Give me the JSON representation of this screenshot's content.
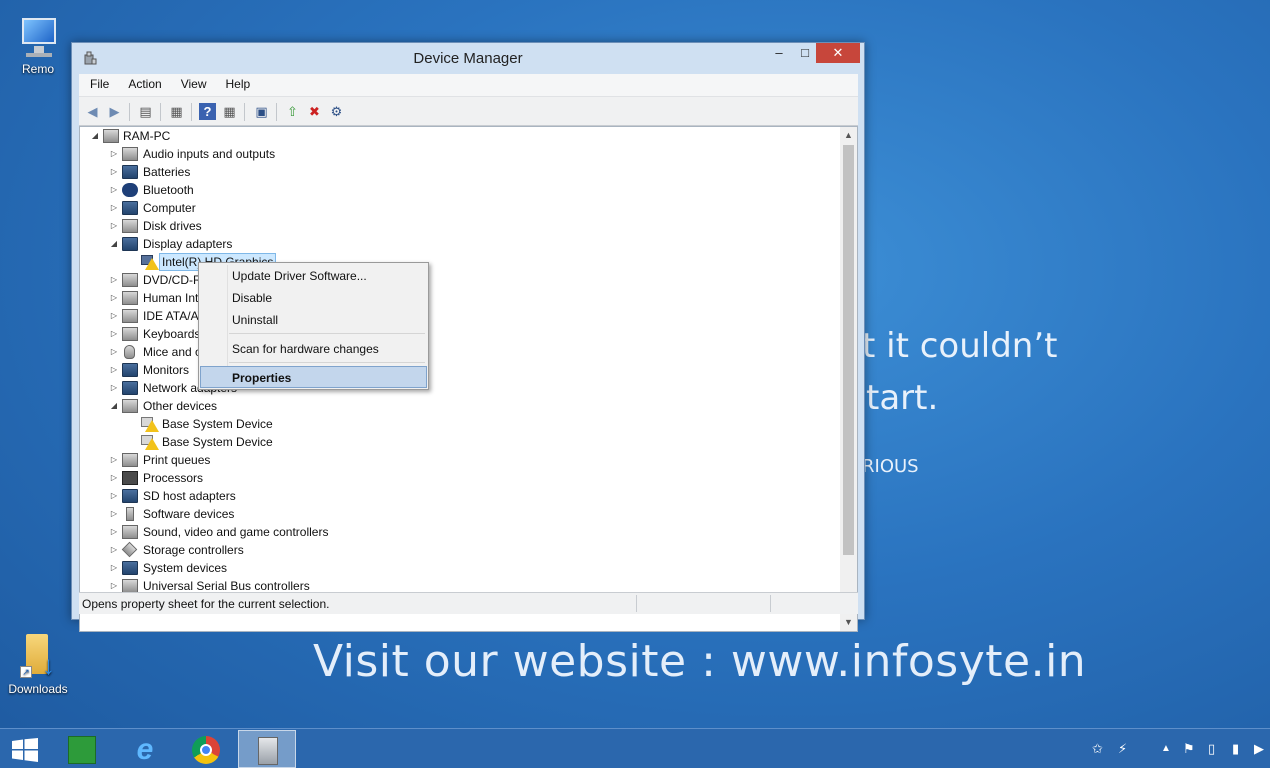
{
  "desktop": {
    "icons": [
      {
        "label": "Remo"
      },
      {
        "label": "Downloads"
      }
    ],
    "background_text": {
      "line1": "t it couldn’t",
      "line2": "tart.",
      "line3": "RIOUS",
      "website": "Visit our website :  www.infosyte.in"
    }
  },
  "window": {
    "title": "Device Manager",
    "controls": {
      "minimize": "–",
      "maximize": "□",
      "close": "✕"
    },
    "menu": [
      "File",
      "Action",
      "View",
      "Help"
    ],
    "toolbar_icons": [
      "back-icon",
      "forward-icon",
      "show-hide-tree-icon",
      "properties-icon",
      "help-icon",
      "view-icon",
      "monitor-icon",
      "update-driver-icon",
      "uninstall-icon",
      "scan-icon"
    ],
    "tree": {
      "root": "RAM-PC",
      "nodes": [
        {
          "label": "Audio inputs and outputs",
          "state": "collapsed"
        },
        {
          "label": "Batteries",
          "state": "collapsed"
        },
        {
          "label": "Bluetooth",
          "state": "collapsed"
        },
        {
          "label": "Computer",
          "state": "collapsed"
        },
        {
          "label": "Disk drives",
          "state": "collapsed"
        },
        {
          "label": "Display adapters",
          "state": "expanded"
        },
        {
          "label": "Intel(R) HD Graphics",
          "state": "child-selected"
        },
        {
          "label": "DVD/CD-ROM drives",
          "state": "collapsed"
        },
        {
          "label": "Human Interface Devices",
          "state": "collapsed"
        },
        {
          "label": "IDE ATA/ATAPI controllers",
          "state": "collapsed"
        },
        {
          "label": "Keyboards",
          "state": "collapsed"
        },
        {
          "label": "Mice and other pointing devices",
          "state": "collapsed"
        },
        {
          "label": "Monitors",
          "state": "collapsed"
        },
        {
          "label": "Network adapters",
          "state": "collapsed"
        },
        {
          "label": "Other devices",
          "state": "expanded"
        },
        {
          "label": "Base System Device",
          "state": "child-warning"
        },
        {
          "label": "Base System Device",
          "state": "child-warning"
        },
        {
          "label": "Print queues",
          "state": "collapsed"
        },
        {
          "label": "Processors",
          "state": "collapsed"
        },
        {
          "label": "SD host adapters",
          "state": "collapsed"
        },
        {
          "label": "Software devices",
          "state": "collapsed"
        },
        {
          "label": "Sound, video and game controllers",
          "state": "collapsed"
        },
        {
          "label": "Storage controllers",
          "state": "collapsed"
        },
        {
          "label": "System devices",
          "state": "collapsed"
        },
        {
          "label": "Universal Serial Bus controllers",
          "state": "collapsed"
        }
      ]
    },
    "status": "Opens property sheet for the current selection."
  },
  "context_menu": {
    "items": [
      {
        "label": "Update Driver Software..."
      },
      {
        "label": "Disable"
      },
      {
        "label": "Uninstall"
      },
      {
        "label": "Scan for hardware changes"
      },
      {
        "label": "Properties",
        "selected": true
      }
    ]
  },
  "taskbar": {
    "apps": [
      "windows-start-icon",
      "store-icon",
      "internet-explorer-icon",
      "chrome-icon",
      "device-manager-icon"
    ]
  },
  "colors": {
    "desktop": "#2a73bf",
    "taskbar": "#2b67ad",
    "close_button": "#c7463b",
    "selection": "#cce8ff",
    "context_highlight": "#c3d6ec"
  }
}
